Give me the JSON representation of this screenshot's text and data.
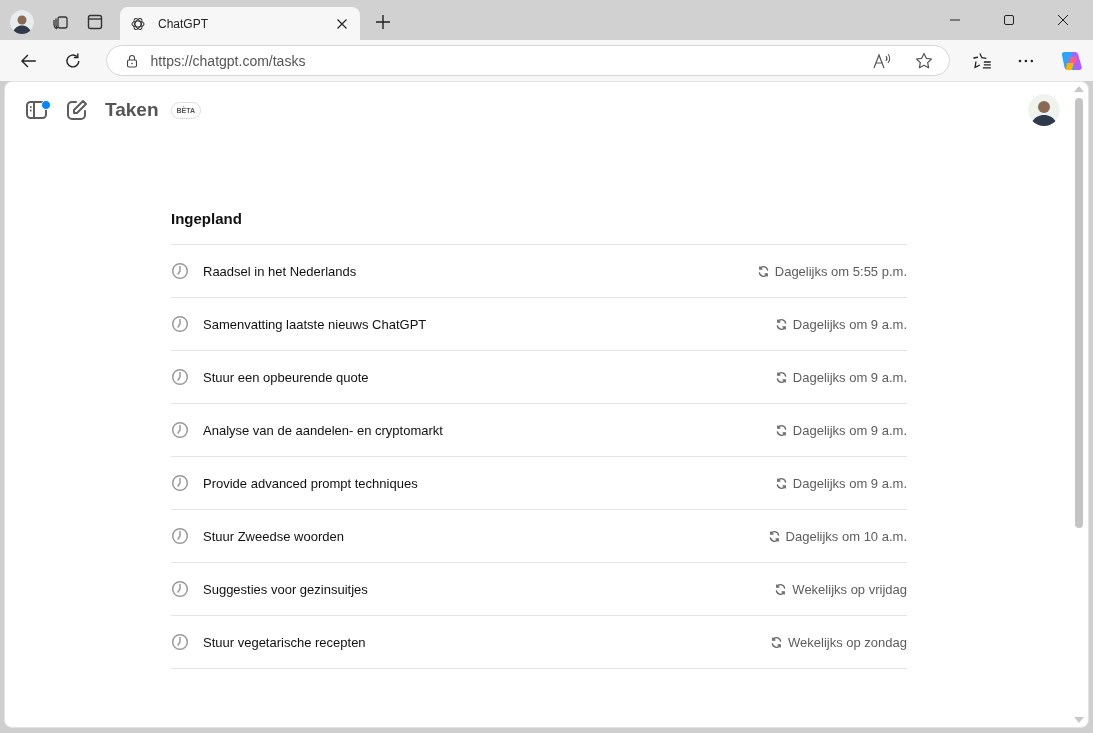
{
  "browser": {
    "tab": {
      "title": "ChatGPT",
      "selected": true
    },
    "url": "https://chatgpt.com/tasks"
  },
  "header": {
    "sidebar_notification": true,
    "title": "Taken",
    "badge": "BÈTA"
  },
  "section": {
    "title": "Ingepland",
    "tasks": [
      {
        "name": "Raadsel in het Nederlands",
        "schedule": "Dagelijks om 5:55 p.m."
      },
      {
        "name": "Samenvatting laatste nieuws ChatGPT",
        "schedule": "Dagelijks om 9 a.m."
      },
      {
        "name": "Stuur een opbeurende quote",
        "schedule": "Dagelijks om 9 a.m."
      },
      {
        "name": "Analyse van de aandelen- en cryptomarkt",
        "schedule": "Dagelijks om 9 a.m."
      },
      {
        "name": "Provide advanced prompt techniques",
        "schedule": "Dagelijks om 9 a.m."
      },
      {
        "name": "Stuur Zweedse woorden",
        "schedule": "Dagelijks om 10 a.m."
      },
      {
        "name": "Suggesties voor gezinsuitjes",
        "schedule": "Wekelijks op vrijdag"
      },
      {
        "name": "Stuur vegetarische recepten",
        "schedule": "Wekelijks op zondag"
      }
    ]
  }
}
